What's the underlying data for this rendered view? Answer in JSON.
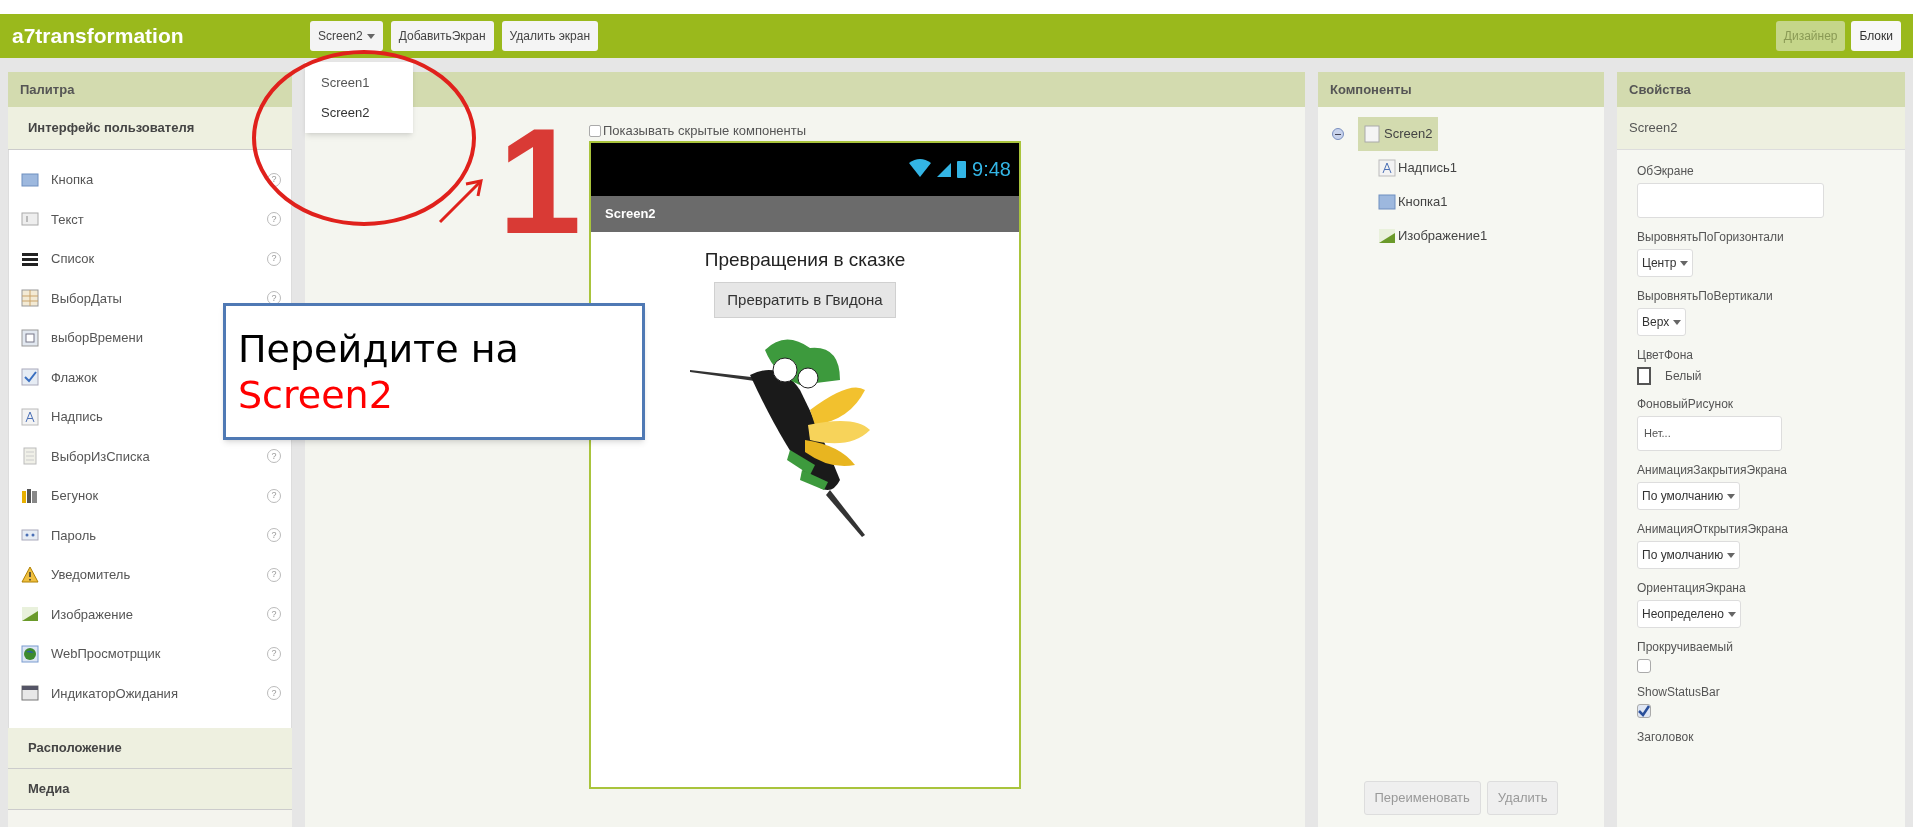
{
  "app": {
    "title": "a7transformation"
  },
  "toolbar": {
    "screen_dropdown": "Screen2",
    "buttons": [
      "ДобавитьЭкран",
      "Удалить экран"
    ]
  },
  "screen_menu": [
    {
      "label": "Screen1",
      "selected": false
    },
    {
      "label": "Screen2",
      "selected": true
    }
  ],
  "mode_tabs": [
    {
      "label": "Дизайнер",
      "selected": true
    },
    {
      "label": "Блоки",
      "selected": false
    }
  ],
  "palette": {
    "title": "Палитра",
    "open_section": "Интерфейс пользователя",
    "items": [
      "Кнопка",
      "Текст",
      "Список",
      "ВыборДаты",
      "выборВремени",
      "Флажок",
      "Надпись",
      "ВыборИзСписка",
      "Бегунок",
      "Пароль",
      "Уведомитель",
      "Изображение",
      "WebПросмотрщик",
      "ИндикаторОжидания"
    ],
    "help_mark": "?",
    "closed_sections": [
      "Расположение",
      "Медиа"
    ]
  },
  "viewer": {
    "show_hidden": {
      "label": "Показывать скрытые компоненты",
      "checked": false
    },
    "phone": {
      "time": "9:48",
      "title": "Screen2",
      "label": "Превращения в сказке",
      "button": "Превратить в Гвидона"
    }
  },
  "components": {
    "title": "Компоненты",
    "tree": [
      {
        "label": "Screen2",
        "selected": true,
        "expanded": true,
        "children": [
          {
            "label": "Надпись1",
            "selected": false
          },
          {
            "label": "Кнопка1",
            "selected": false
          },
          {
            "label": "Изображение1",
            "selected": false
          }
        ]
      }
    ],
    "buttons": [
      "Переименовать",
      "Удалить"
    ]
  },
  "properties": {
    "title": "Свойства",
    "component": "Screen2",
    "fields": [
      {
        "kind": "textarea",
        "label": "ОбЭкране"
      },
      {
        "kind": "dropdown",
        "label": "ВыровнятьПоГоризонтали",
        "value": "Центр"
      },
      {
        "kind": "dropdown",
        "label": "ВыровнятьПоВертикали",
        "value": "Верх"
      },
      {
        "kind": "color",
        "label": "ЦветФона",
        "value": "Белый",
        "color": "#ffffff"
      },
      {
        "kind": "picker",
        "label": "ФоновыйРисунок",
        "value": "Нет..."
      },
      {
        "kind": "dropdown",
        "label": "АнимацияЗакрытияЭкрана",
        "value": "По умолчанию"
      },
      {
        "kind": "dropdown",
        "label": "АнимацияОткрытияЭкрана",
        "value": "По умолчанию"
      },
      {
        "kind": "dropdown",
        "label": "ОриентацияЭкрана",
        "value": "Неопределено"
      },
      {
        "kind": "checkbox",
        "label": "Прокручиваемый",
        "checked": false
      },
      {
        "kind": "checkbox",
        "label": "ShowStatusBar",
        "checked": true
      },
      {
        "kind": "label",
        "label": "Заголовок"
      }
    ]
  },
  "annotation": {
    "number": "1",
    "callout": "Перейдите на",
    "callout_highlight": "Screen2"
  }
}
